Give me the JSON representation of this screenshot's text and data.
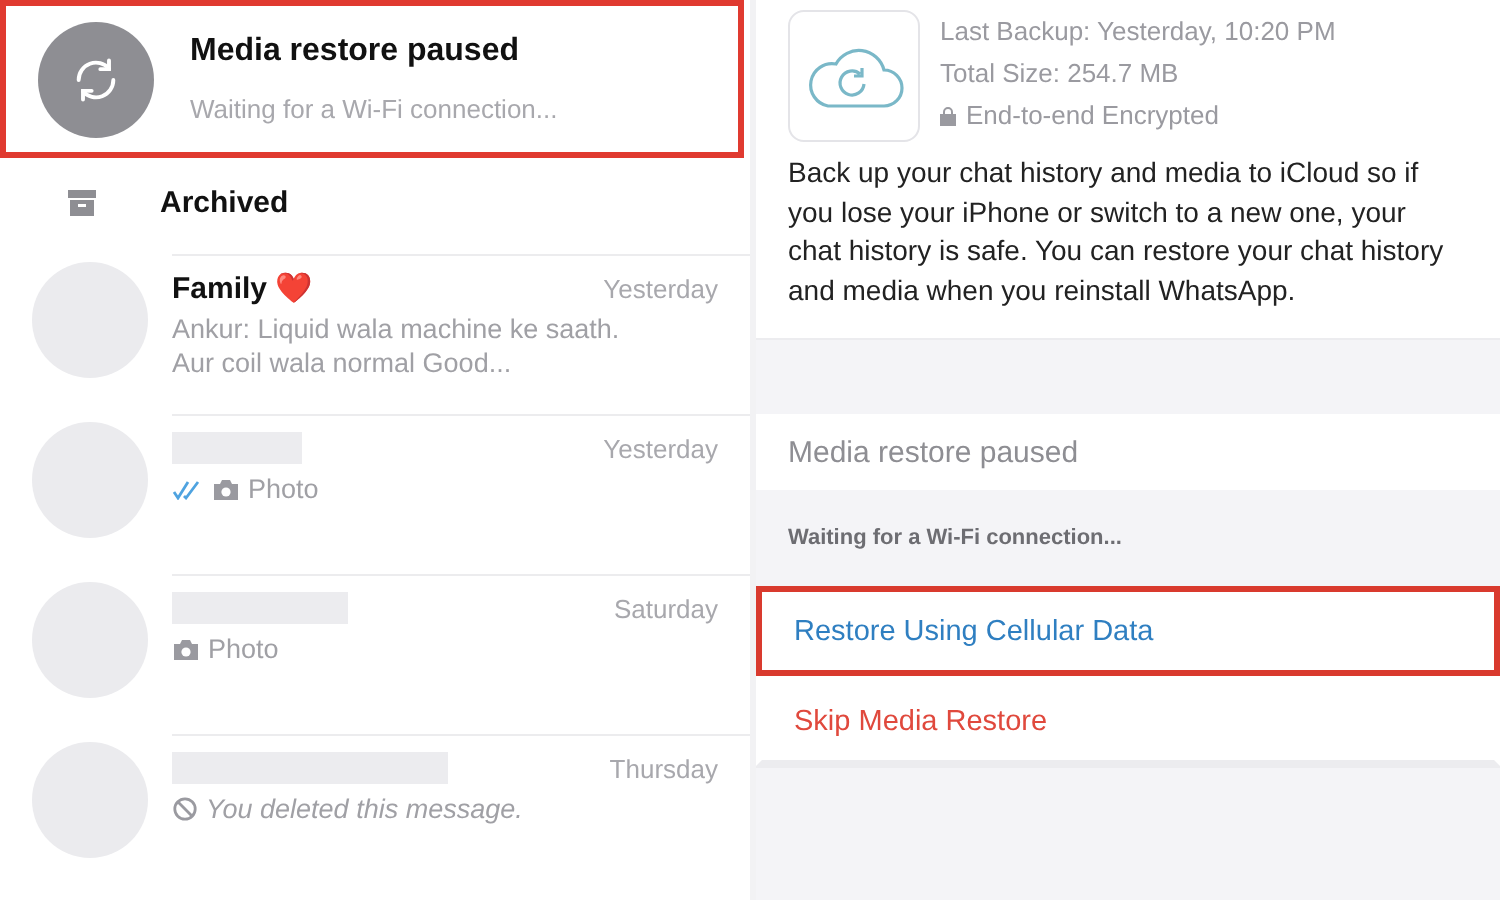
{
  "restore_banner": {
    "title": "Media restore paused",
    "subtitle": "Waiting for a Wi-Fi connection...",
    "highlighted": true
  },
  "archived": {
    "label": "Archived"
  },
  "chats": [
    {
      "name": "Family ❤️",
      "time": "Yesterday",
      "preview": "Ankur: Liquid wala machine ke saath. Aur coil wala normal Good...",
      "kind": "text"
    },
    {
      "time": "Yesterday",
      "preview": "Photo",
      "kind": "photo",
      "read": true
    },
    {
      "time": "Saturday",
      "preview": "Photo",
      "kind": "photo",
      "read": false
    },
    {
      "time": "Thursday",
      "preview": "You deleted this message.",
      "kind": "deleted"
    }
  ],
  "backup": {
    "last_backup": "Last Backup: Yesterday, 10:20 PM",
    "total_size": "Total Size: 254.7 MB",
    "encryption": "End-to-end Encrypted",
    "description": "Back up your chat history and media to iCloud so if you lose your iPhone or switch to a new one, your chat history is safe. You can restore your chat history and media when you reinstall WhatsApp."
  },
  "restore_status": {
    "title": "Media restore paused",
    "detail": "Waiting for a Wi-Fi connection..."
  },
  "actions": [
    {
      "label": "Restore Using Cellular Data",
      "kind": "primary",
      "highlighted": true
    },
    {
      "label": "Skip Media Restore",
      "kind": "destructive",
      "highlighted": false
    }
  ]
}
